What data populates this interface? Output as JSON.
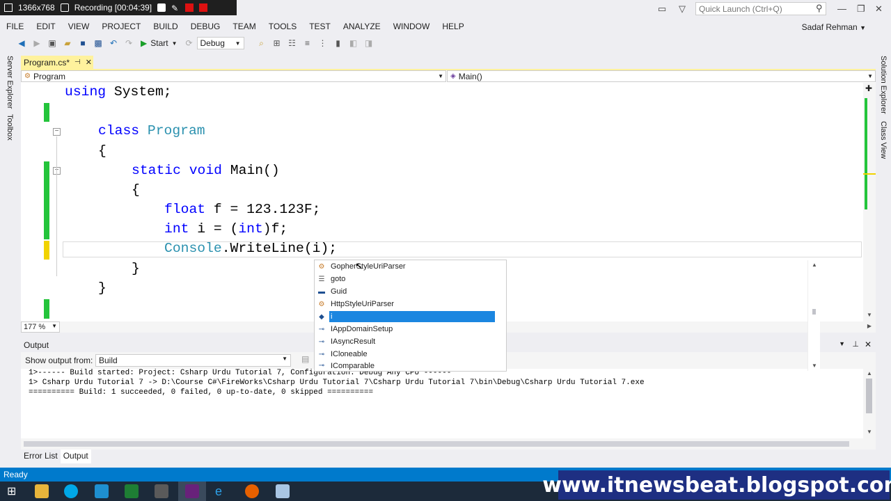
{
  "recorder": {
    "resolution": "1366x768",
    "recording": "Recording [00:04:39]"
  },
  "quick_launch": {
    "placeholder": "Quick Launch (Ctrl+Q)"
  },
  "menu": [
    "FILE",
    "EDIT",
    "VIEW",
    "PROJECT",
    "BUILD",
    "DEBUG",
    "TEAM",
    "TOOLS",
    "TEST",
    "ANALYZE",
    "WINDOW",
    "HELP"
  ],
  "user": "Sadaf Rehman",
  "toolbar": {
    "start_label": "Start",
    "config": "Debug"
  },
  "left_strip": [
    "Server Explorer",
    "Toolbox"
  ],
  "right_strip": [
    "Solution Explorer",
    "Class View"
  ],
  "doc_tab": {
    "label": "Program.cs*",
    "pin": "⊣",
    "close": "✕"
  },
  "nav": {
    "class": "Program",
    "member": "Main()"
  },
  "code_lines": {
    "l1": {
      "kw": "using",
      "rest": " System;"
    },
    "l2": {
      "kw": "class",
      "ty": " Program"
    },
    "l3": {
      "text": "{"
    },
    "l4": {
      "kw1": "static",
      "kw2": " void",
      "rest": " Main()"
    },
    "l5": {
      "text": "{"
    },
    "l6": {
      "kw": "float",
      "rest": " f = 123.123F;"
    },
    "l7": {
      "kw": "int",
      "rest1": " i = (",
      "kw2": "int",
      "rest2": ")f;"
    },
    "l8": {
      "ty": "Console",
      "rest": ".WriteLine(i);"
    },
    "l9": {
      "text": "}"
    },
    "l10": {
      "text": "}"
    }
  },
  "zoom": "177 %",
  "intellisense": [
    {
      "label": "GopherStyleUriParser",
      "icon": "class-icon"
    },
    {
      "label": "goto",
      "icon": "snippet-icon"
    },
    {
      "label": "Guid",
      "icon": "struct-icon"
    },
    {
      "label": "HttpStyleUriParser",
      "icon": "class-icon"
    },
    {
      "label": "i",
      "icon": "local-variable-icon",
      "selected": true
    },
    {
      "label": "IAppDomainSetup",
      "icon": "interface-icon"
    },
    {
      "label": "IAsyncResult",
      "icon": "interface-icon"
    },
    {
      "label": "ICloneable",
      "icon": "interface-icon"
    },
    {
      "label": "IComparable",
      "icon": "interface-icon"
    }
  ],
  "output": {
    "title": "Output",
    "show_from_label": "Show output from:",
    "source": "Build",
    "lines": [
      "1>------ Build started: Project: Csharp Urdu Tutorial 7, Configuration: Debug Any CPU ------",
      "1>  Csharp Urdu Tutorial 7 -> D:\\Course C#\\FireWorks\\Csharp Urdu Tutorial 7\\Csharp Urdu Tutorial 7\\bin\\Debug\\Csharp Urdu Tutorial 7.exe",
      "========== Build: 1 succeeded, 0 failed, 0 up-to-date, 0 skipped =========="
    ]
  },
  "bottom_tabs": {
    "error_list": "Error List",
    "output": "Output"
  },
  "status": "Ready",
  "watermark": "www.itnewsbeat.blogspot.com",
  "colors": {
    "accent": "#007acc",
    "keyword": "#0000ff",
    "type": "#2b91af",
    "tab_modified": "#fff29d",
    "selection": "#1b86e0"
  }
}
